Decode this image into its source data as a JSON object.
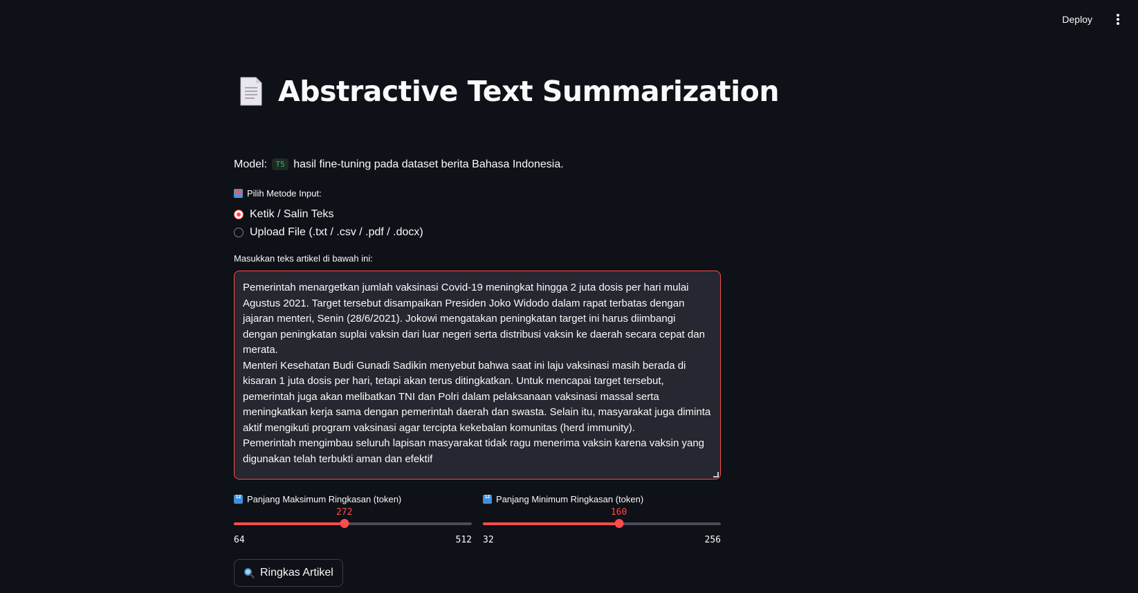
{
  "topbar": {
    "deploy_label": "Deploy",
    "menu_icon": "more-vert-icon"
  },
  "header": {
    "icon": "page-facing-up-icon",
    "title": "Abstractive Text Summarization"
  },
  "model_info": {
    "prefix": "Model:",
    "model_code": "T5",
    "suffix": "hasil fine-tuning pada dataset berita Bahasa Indonesia."
  },
  "input_method": {
    "icon": "inbox-tray-icon",
    "label": "Pilih Metode Input:",
    "options": [
      {
        "label": "Ketik / Salin Teks",
        "selected": true
      },
      {
        "label": "Upload File (.txt / .csv / .pdf / .docx)",
        "selected": false
      }
    ]
  },
  "article": {
    "label": "Masukkan teks artikel di bawah ini:",
    "paragraphs": [
      "Pemerintah menargetkan jumlah vaksinasi Covid-19 meningkat hingga 2 juta dosis per hari mulai Agustus 2021. Target tersebut disampaikan Presiden Joko Widodo dalam rapat terbatas dengan jajaran menteri, Senin (28/6/2021). Jokowi mengatakan peningkatan target ini harus diimbangi dengan peningkatan suplai vaksin dari luar negeri serta distribusi vaksin ke daerah secara cepat dan merata.",
      "Menteri Kesehatan Budi Gunadi Sadikin menyebut bahwa saat ini laju vaksinasi masih berada di kisaran 1 juta dosis per hari, tetapi akan terus ditingkatkan. Untuk mencapai target tersebut, pemerintah juga akan melibatkan TNI dan Polri dalam pelaksanaan vaksinasi massal serta meningkatkan kerja sama dengan pemerintah daerah dan swasta. Selain itu, masyarakat juga diminta aktif mengikuti program vaksinasi agar tercipta kekebalan komunitas (herd immunity).",
      "Pemerintah mengimbau seluruh lapisan masyarakat tidak ragu menerima vaksin karena vaksin yang digunakan telah terbukti aman dan efektif"
    ]
  },
  "sliders": {
    "max_len": {
      "icon": "input-numbers-icon",
      "label": "Panjang Maksimum Ringkasan (token)",
      "value": 272,
      "min": 64,
      "max": 512
    },
    "min_len": {
      "icon": "input-numbers-icon",
      "label": "Panjang Minimum Ringkasan (token)",
      "value": 160,
      "min": 32,
      "max": 256
    }
  },
  "action": {
    "icon": "magnifying-glass-icon",
    "label": "Ringkas Artikel"
  },
  "colors": {
    "background": "#0e1117",
    "accent": "#ff4b4b",
    "input_bg": "#262730",
    "code_green": "#21c354"
  }
}
